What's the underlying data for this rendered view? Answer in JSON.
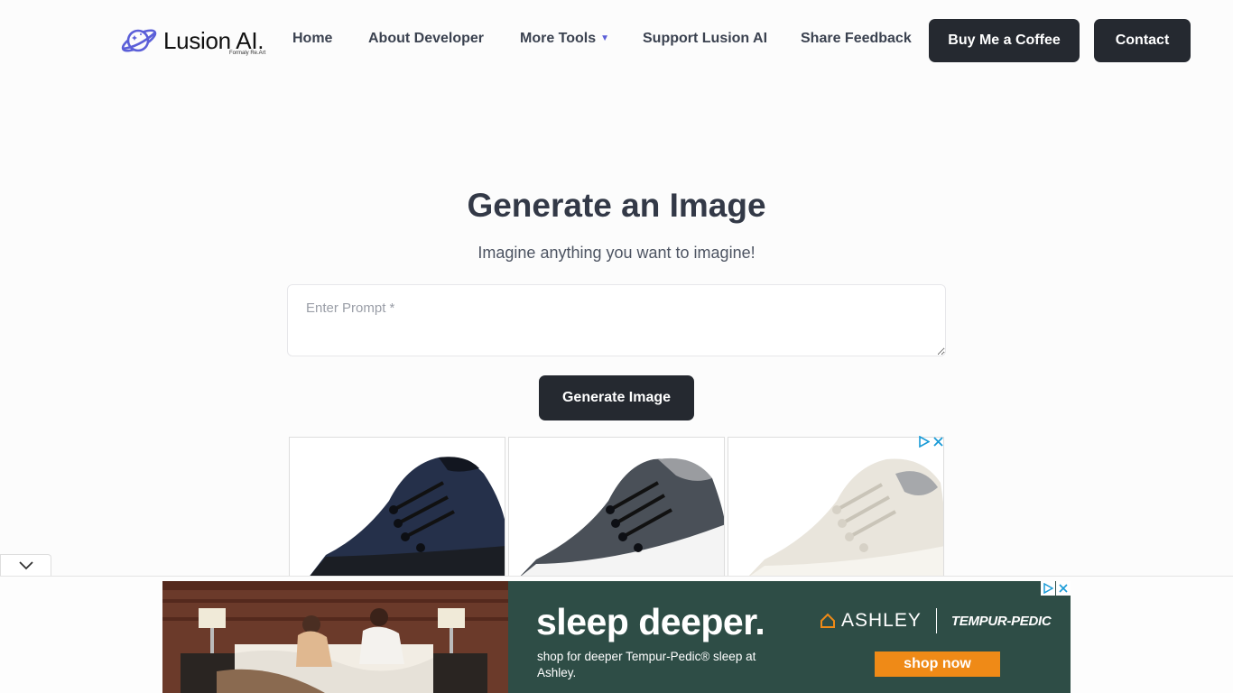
{
  "header": {
    "logo_text": "Lusion AI.",
    "logo_sub": "Formaly Re.Art",
    "nav": [
      {
        "label": "Home"
      },
      {
        "label": "About Developer"
      },
      {
        "label": "More Tools"
      },
      {
        "label": "Support Lusion AI"
      },
      {
        "label": "Share Feedback"
      }
    ],
    "buy_coffee": "Buy Me a Coffee",
    "contact": "Contact"
  },
  "main": {
    "title": "Generate an Image",
    "subtitle": "Imagine anything you want to imagine!",
    "prompt_placeholder": "Enter Prompt *",
    "prompt_value": "",
    "generate_button": "Generate Image"
  },
  "shoe_ad": {
    "items": [
      {
        "color": "#25304a"
      },
      {
        "color": "#4a5058"
      },
      {
        "color": "#e9e5dc"
      }
    ]
  },
  "bottom_ad": {
    "headline": "sleep deeper.",
    "copy": "shop for deeper Tempur-Pedic® sleep at Ashley.",
    "brand_1": "ASHLEY",
    "brand_2": "TEMPUR-PEDIC",
    "cta": "shop now",
    "bg_color": "#2e4d46",
    "cta_color": "#ef8a17"
  },
  "colors": {
    "accent": "#5b5fd8",
    "button_dark": "#252930"
  }
}
